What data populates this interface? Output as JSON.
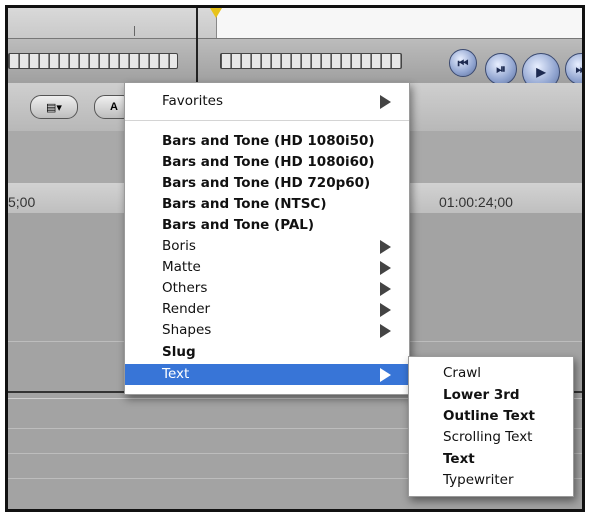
{
  "timecodes": {
    "left": "5;00",
    "right": "01:00:24;00"
  },
  "toolbar": {
    "button1_icon": "list-icon",
    "button2_icon": "text-icon"
  },
  "transport": {
    "buttons": [
      "go-to-start-icon",
      "play-in-to-out-icon",
      "play-icon",
      "next-icon"
    ]
  },
  "generator_menu": {
    "items": [
      {
        "label": "Favorites",
        "bold": false,
        "submenu": true
      },
      {
        "label": "Bars and Tone (HD 1080i50)",
        "bold": true,
        "submenu": false
      },
      {
        "label": "Bars and Tone (HD 1080i60)",
        "bold": true,
        "submenu": false
      },
      {
        "label": "Bars and Tone (HD 720p60)",
        "bold": true,
        "submenu": false
      },
      {
        "label": "Bars and Tone (NTSC)",
        "bold": true,
        "submenu": false
      },
      {
        "label": "Bars and Tone (PAL)",
        "bold": true,
        "submenu": false
      },
      {
        "label": "Boris",
        "bold": false,
        "submenu": true
      },
      {
        "label": "Matte",
        "bold": false,
        "submenu": true
      },
      {
        "label": "Others",
        "bold": false,
        "submenu": true
      },
      {
        "label": "Render",
        "bold": false,
        "submenu": true
      },
      {
        "label": "Shapes",
        "bold": false,
        "submenu": true
      },
      {
        "label": "Slug",
        "bold": true,
        "submenu": false
      },
      {
        "label": "Text",
        "bold": false,
        "submenu": true,
        "selected": true
      }
    ]
  },
  "text_submenu": {
    "items": [
      {
        "label": "Crawl",
        "bold": false
      },
      {
        "label": "Lower 3rd",
        "bold": true
      },
      {
        "label": "Outline Text",
        "bold": true
      },
      {
        "label": "Scrolling Text",
        "bold": false
      },
      {
        "label": "Text",
        "bold": true
      },
      {
        "label": "Typewriter",
        "bold": false
      }
    ]
  },
  "colors": {
    "selection": "#3875d7",
    "playhead": "#e8c31a"
  }
}
